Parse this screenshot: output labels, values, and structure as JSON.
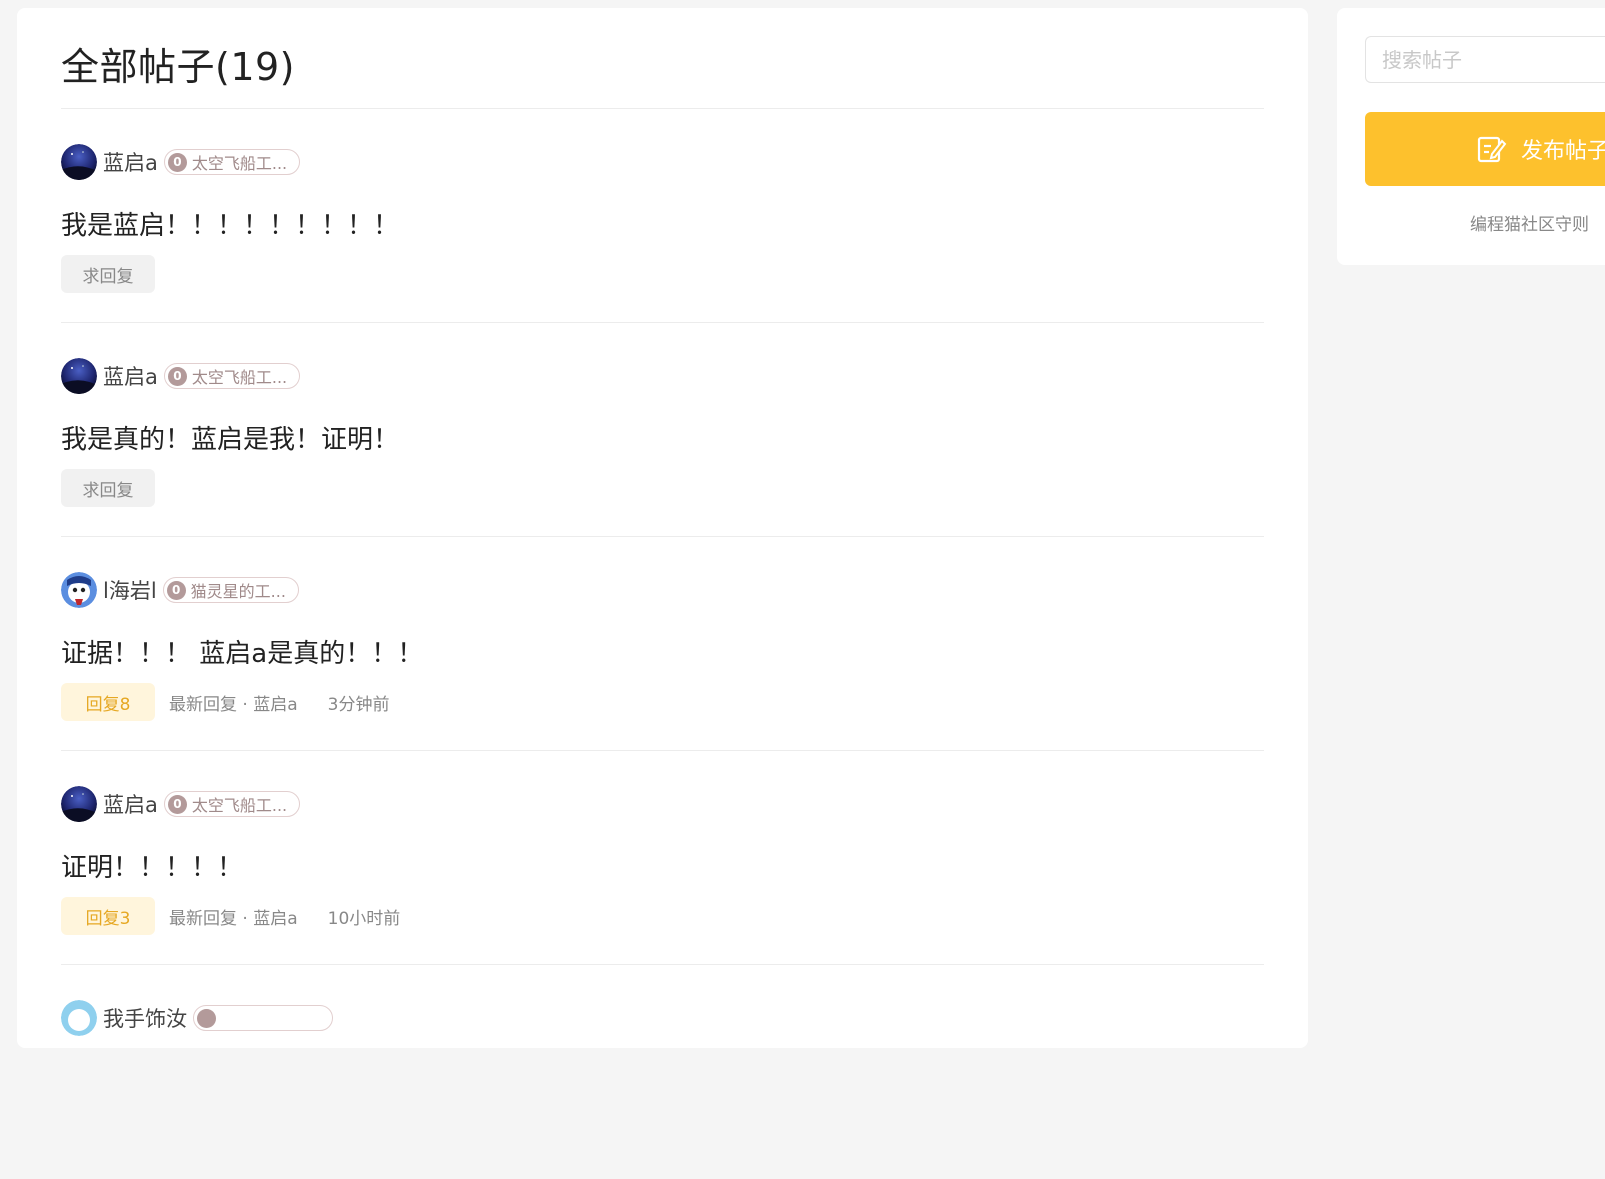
{
  "main": {
    "title": "全部帖子(19)",
    "posts": [
      {
        "author": "蓝启a",
        "badge_level": "0",
        "badge_text": "太空飞船工...",
        "content": "我是蓝启！！！！！！！！！",
        "tag": "求回复",
        "tag_style": "gray",
        "latest": "",
        "time": ""
      },
      {
        "author": "蓝启a",
        "badge_level": "0",
        "badge_text": "太空飞船工...",
        "content": "我是真的！蓝启是我！证明！",
        "tag": "求回复",
        "tag_style": "gray",
        "latest": "",
        "time": ""
      },
      {
        "author": "l海岩l",
        "badge_level": "0",
        "badge_text": "猫灵星的工...",
        "content": "证据！！！ 蓝启a是真的！！！",
        "tag": "回复8",
        "tag_style": "yellow",
        "latest": "最新回复 · 蓝启a",
        "time": "3分钟前"
      },
      {
        "author": "蓝启a",
        "badge_level": "0",
        "badge_text": "太空飞船工...",
        "content": "证明！！！！！",
        "tag": "回复3",
        "tag_style": "yellow",
        "latest": "最新回复 · 蓝启a",
        "time": "10小时前"
      },
      {
        "author": "我手饰汝",
        "badge_level": "",
        "badge_text": "",
        "content": "",
        "tag": "",
        "tag_style": "gray",
        "latest": "",
        "time": ""
      }
    ]
  },
  "sidebar": {
    "search_placeholder": "搜索帖子",
    "publish_label": "发布帖子",
    "footer_text": "编程猫社区守则"
  },
  "colors": {
    "accent": "#fdc12d",
    "reply_tag_bg": "#fff5dc",
    "reply_tag_text": "#e6a823"
  }
}
